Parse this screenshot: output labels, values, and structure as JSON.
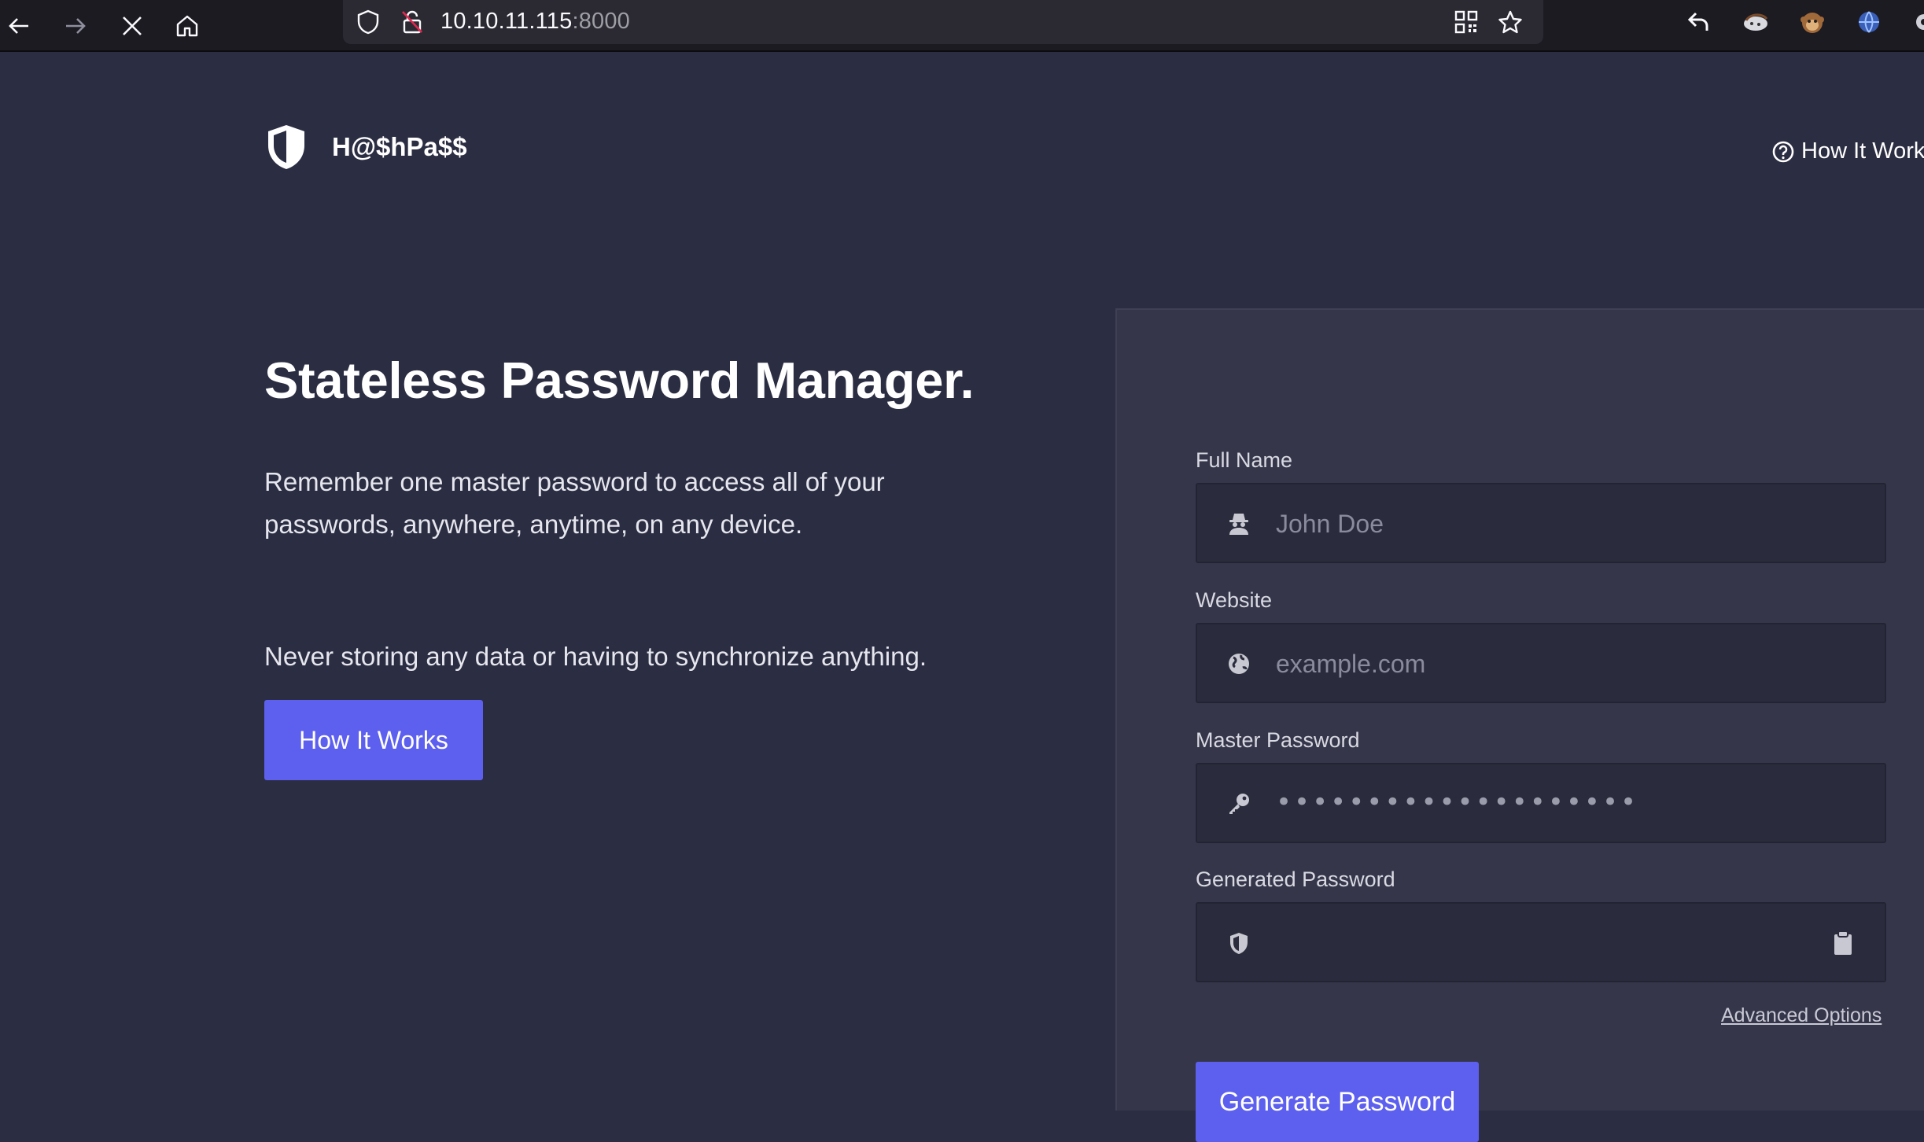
{
  "browser": {
    "url_host": "10.10.11.115",
    "url_port": ":8000",
    "icons": [
      "back-arrow-icon",
      "forward-arrow-icon",
      "stop-icon",
      "home-icon",
      "shield-icon",
      "insecure-lock-icon",
      "qr-code-icon",
      "star-icon",
      "undo-icon",
      "extension-icons"
    ]
  },
  "header": {
    "logo_text": "H@$hPa$$",
    "how_it_works_link": "How It Works"
  },
  "hero": {
    "title": "Stateless Password Manager.",
    "description": "Remember one master password to access all of your passwords, anywhere, anytime, on any device.",
    "description2": "Never storing any data or having to synchronize anything.",
    "button_label": "How It Works"
  },
  "form": {
    "full_name_label": "Full Name",
    "full_name_placeholder": "John Doe",
    "website_label": "Website",
    "website_placeholder": "example.com",
    "master_password_label": "Master Password",
    "master_password_value": "••••••••••••••••••••",
    "generated_password_label": "Generated Password",
    "generated_password_value": "",
    "advanced_options": "Advanced Options",
    "generate_button": "Generate Password"
  },
  "colors": {
    "page_bg": "#2b2d42",
    "panel_bg": "#353649",
    "accent": "#5d5fef"
  }
}
